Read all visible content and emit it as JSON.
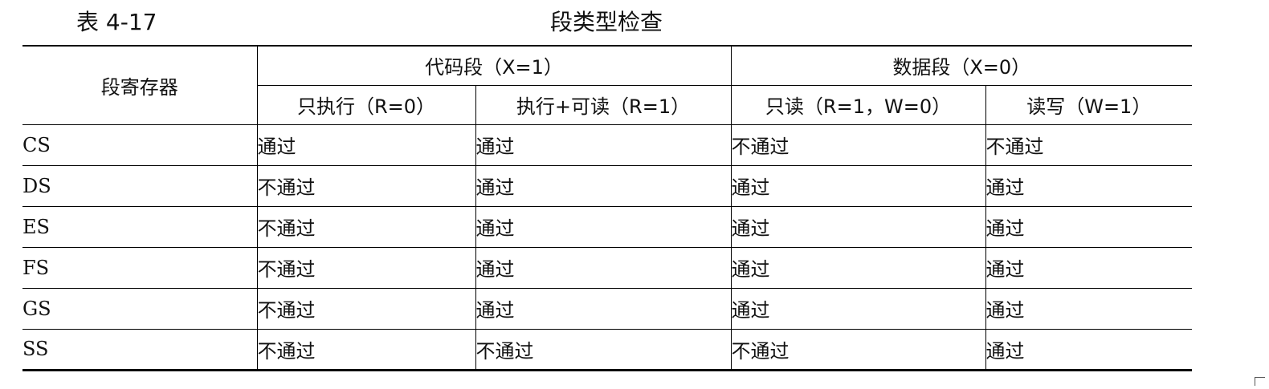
{
  "caption": {
    "number": "表 4-17",
    "title": "段类型检查"
  },
  "header": {
    "register_col": "段寄存器",
    "code_segment": "代码段（X=1）",
    "data_segment": "数据段（X=0）",
    "sub": [
      "只执行（R=0）",
      "执行+可读（R=1）",
      "只读（R=1，W=0）",
      "读写（W=1）"
    ]
  },
  "rows": [
    {
      "reg": "CS",
      "cells": [
        "通过",
        "通过",
        "不通过",
        "不通过"
      ]
    },
    {
      "reg": "DS",
      "cells": [
        "不通过",
        "通过",
        "通过",
        "通过"
      ]
    },
    {
      "reg": "ES",
      "cells": [
        "不通过",
        "通过",
        "通过",
        "通过"
      ]
    },
    {
      "reg": "FS",
      "cells": [
        "不通过",
        "通过",
        "通过",
        "通过"
      ]
    },
    {
      "reg": "GS",
      "cells": [
        "不通过",
        "通过",
        "通过",
        "通过"
      ]
    },
    {
      "reg": "SS",
      "cells": [
        "不通过",
        "不通过",
        "不通过",
        "通过"
      ]
    }
  ]
}
